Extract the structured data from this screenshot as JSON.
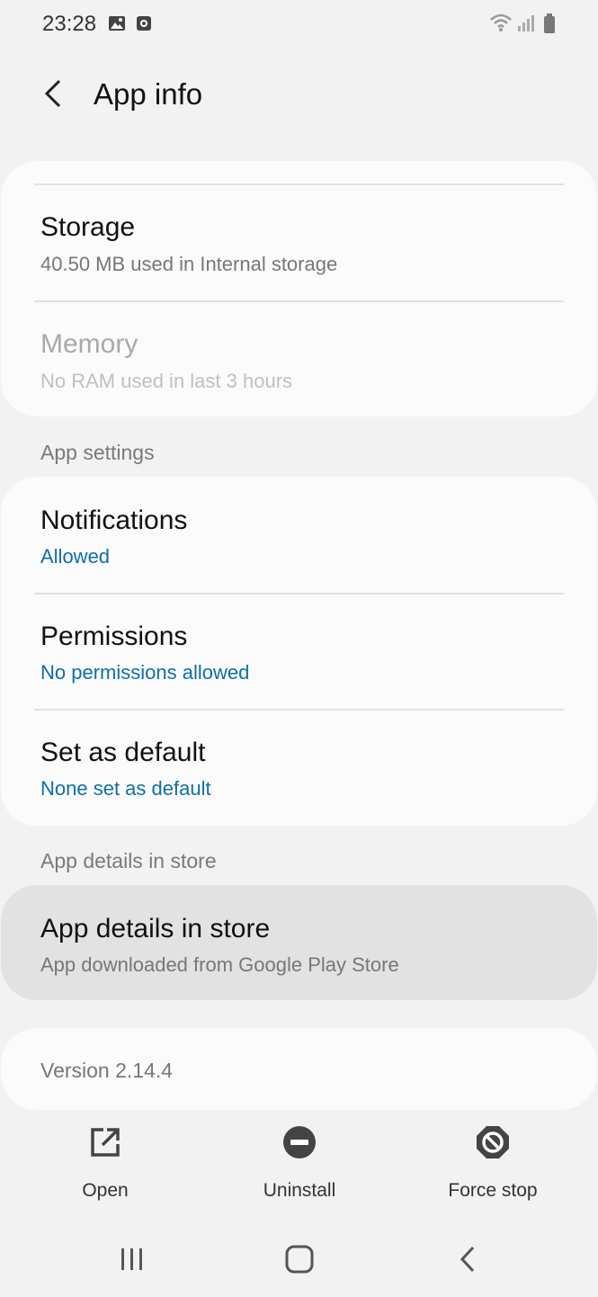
{
  "status_bar": {
    "time": "23:28",
    "icons_left": [
      "image-icon",
      "screen-record-icon"
    ],
    "icons_right": [
      "wifi-icon",
      "signal-icon",
      "battery-icon"
    ]
  },
  "header": {
    "title": "App info",
    "back_icon": "back-arrow-icon"
  },
  "card_top": {
    "storage_title": "Storage",
    "storage_sub": "40.50 MB used in Internal storage",
    "memory_title": "Memory",
    "memory_sub": "No RAM used in last 3 hours"
  },
  "app_settings": {
    "section_label": "App settings",
    "items": [
      {
        "title": "Notifications",
        "sub": "Allowed"
      },
      {
        "title": "Permissions",
        "sub": "No permissions allowed"
      },
      {
        "title": "Set as default",
        "sub": "None set as default"
      }
    ]
  },
  "store": {
    "section_label": "App details in store",
    "title": "App details in store",
    "sub": "App downloaded from Google Play Store"
  },
  "version": {
    "text": "Version 2.14.4"
  },
  "actions": {
    "open_label": "Open",
    "uninstall_label": "Uninstall",
    "force_stop_label": "Force stop"
  },
  "nav_bar": {
    "buttons": [
      "recents-icon",
      "home-icon",
      "back-icon"
    ]
  },
  "colors": {
    "background": "#f2f2f2",
    "card": "#fbfbfb",
    "accent_blue": "#0f6fa8",
    "pressed_card": "#e2e2e2"
  }
}
